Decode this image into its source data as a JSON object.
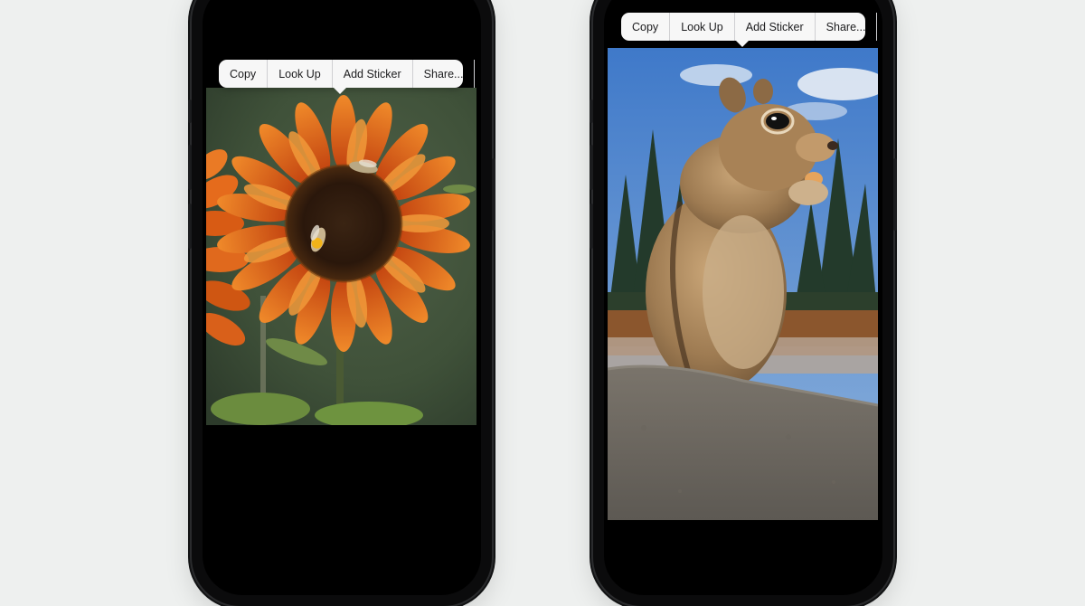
{
  "phones": [
    {
      "subject": "sunflower-with-bees",
      "menu": {
        "items": [
          "Copy",
          "Look Up",
          "Add Sticker",
          "Share..."
        ]
      }
    },
    {
      "subject": "ground-squirrel-on-rock",
      "menu": {
        "items": [
          "Copy",
          "Look Up",
          "Add Sticker",
          "Share..."
        ]
      }
    }
  ],
  "colors": {
    "background": "#eef0ef",
    "phone_body": "#0b0b0c",
    "menu_bg": "#f7f7f7",
    "menu_text": "#1c1c1e"
  }
}
